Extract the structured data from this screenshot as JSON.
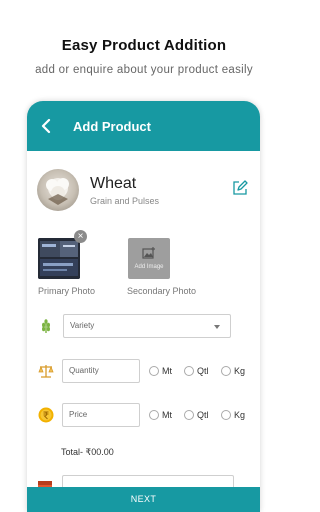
{
  "promo": {
    "title": "Easy Product Addition",
    "subtitle": "add or enquire about your product easily"
  },
  "appbar": {
    "title": "Add Product",
    "back_icon": "arrow-left-icon"
  },
  "product": {
    "name": "Wheat",
    "category": "Grain and Pulses",
    "edit_icon": "edit-icon"
  },
  "photos": {
    "primary_label": "Primary Photo",
    "secondary_label": "Secondary Photo",
    "add_image_label": "Add Image",
    "remove_glyph": "×"
  },
  "form": {
    "variety_placeholder": "Variety",
    "quantity_placeholder": "Quantity",
    "price_placeholder": "Price",
    "units": [
      "Mt",
      "Qtl",
      "Kg"
    ],
    "total_label": "Total- ₹00.00"
  },
  "footer": {
    "next_label": "NEXT"
  },
  "colors": {
    "accent": "#1799a2",
    "variety_icon": "#7cb342",
    "scale_icon": "#d89b2b",
    "rupee_icon": "#f2b100",
    "calendar_icon": "#e4572e"
  }
}
